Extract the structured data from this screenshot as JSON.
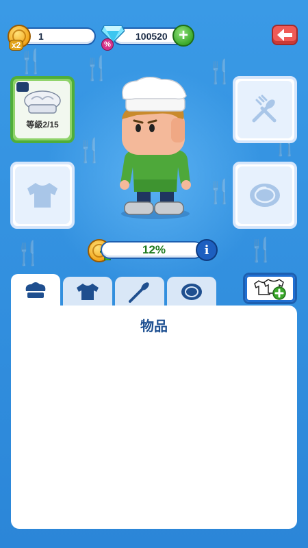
{
  "currency": {
    "coins": "1",
    "coin_multiplier": "x2",
    "gems": "100520"
  },
  "icons": {
    "back": "arrow-left-icon",
    "add_gems": "plus-icon",
    "info": "info-icon"
  },
  "slots": {
    "hat": {
      "level_label": "等級2/15",
      "icon": "chef-hat-icon",
      "selected": true
    },
    "tool": {
      "icon": "spatula-fork-icon"
    },
    "shirt": {
      "icon": "shirt-icon"
    },
    "plate": {
      "icon": "plate-icon"
    }
  },
  "bonus": {
    "percent_label": "12%"
  },
  "tabs": [
    {
      "icon": "chef-hat-icon",
      "active": true
    },
    {
      "icon": "shirt-icon",
      "active": false
    },
    {
      "icon": "spatula-fork-icon",
      "active": false
    },
    {
      "icon": "plate-icon",
      "active": false
    }
  ],
  "panel": {
    "title": "物品"
  },
  "colors": {
    "background": "#2f8fe0",
    "accent_green": "#4fae3a",
    "back_red": "#ef5b57",
    "title_blue": "#1d4f91"
  }
}
